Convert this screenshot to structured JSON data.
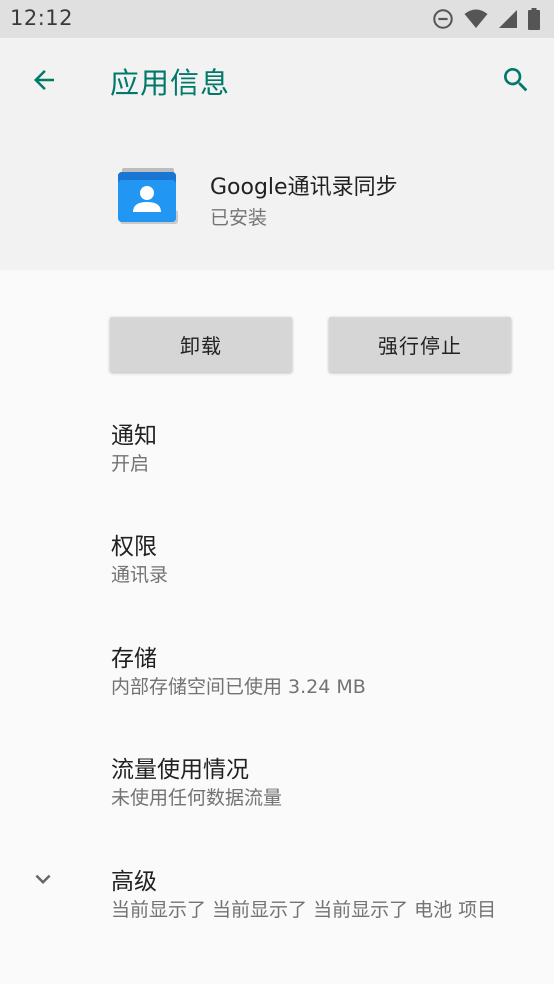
{
  "status_bar": {
    "time": "12:12",
    "icons": [
      "do-not-disturb-icon",
      "wifi-icon",
      "cellular-signal-icon",
      "battery-icon"
    ]
  },
  "app_bar": {
    "title": "应用信息",
    "accent_color": "#00796b"
  },
  "app_header": {
    "name": "Google通讯录同步",
    "status": "已安装",
    "icon": "contacts-app-icon"
  },
  "buttons": {
    "uninstall": "卸载",
    "force_stop": "强行停止"
  },
  "preferences": [
    {
      "id": "notifications",
      "title": "通知",
      "summary": "开启"
    },
    {
      "id": "permissions",
      "title": "权限",
      "summary": "通讯录"
    },
    {
      "id": "storage",
      "title": "存储",
      "summary": "内部存储空间已使用 3.24 MB"
    },
    {
      "id": "data-usage",
      "title": "流量使用情况",
      "summary": "未使用任何数据流量"
    },
    {
      "id": "advanced",
      "title": "高级",
      "summary": "当前显示了 当前显示了 当前显示了 电池 项目"
    }
  ]
}
